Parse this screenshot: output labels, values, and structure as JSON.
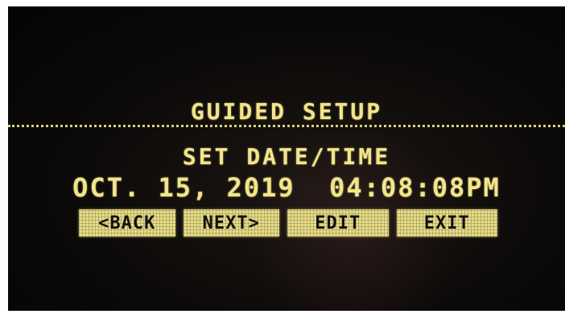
{
  "screen": {
    "title": "GUIDED SETUP",
    "subtitle": "SET DATE/TIME",
    "datetime": "OCT. 15, 2019  04:08:08PM"
  },
  "softkeys": {
    "back": "<BACK",
    "next": "NEXT>",
    "edit": "EDIT",
    "exit": "EXIT"
  },
  "colors": {
    "lcd_text": "#f2e58a",
    "screen_bg": "#0c0a09"
  }
}
